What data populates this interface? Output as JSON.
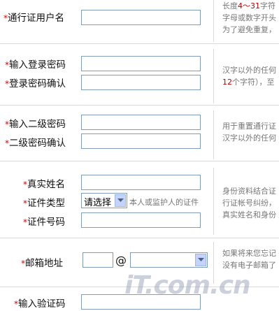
{
  "form": {
    "username_label": "通行证用户名",
    "password_label": "输入登录密码",
    "password_confirm_label": "登录密码确认",
    "second_password_label": "输入二级密码",
    "second_password_confirm_label": "二级密码确认",
    "realname_label": "真实姓名",
    "id_type_label": "证件类型",
    "id_type_value": "请选择",
    "id_type_hint": "本人或监护人的证件",
    "id_number_label": "证件号码",
    "email_label": "邮箱地址",
    "email_at": "@",
    "captcha_label": "输入验证码",
    "required_mark": "*"
  },
  "tips": {
    "username_line1_a": "长度",
    "username_line1_b": "4～31",
    "username_line1_c": "字符",
    "username_line2": "字母或数字开头",
    "username_line3": "为了避免重复，",
    "password_line1": "汉字以外的任何",
    "password_line2_a": "12",
    "password_line2_b": "个字符），至",
    "second_line1": "用于重置通行证",
    "second_line2": "汉字以外的任何",
    "id_line1": "身份资料结合证",
    "id_line2": "行证帐号纠纷，",
    "id_line3": "真实姓名和身份",
    "email_line1": "如果将来您忘记",
    "email_line2": "没有电子邮箱了"
  },
  "watermark": "iT.com.cn",
  "colors": {
    "required": "#d40000",
    "tip_highlight": "#c00000",
    "input_border": "#7f9db9"
  }
}
